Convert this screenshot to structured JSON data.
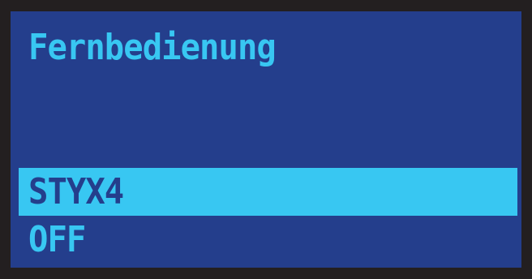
{
  "screen": {
    "title": "Fernbedienung",
    "menu": {
      "items": [
        {
          "label": "STYX4",
          "selected": true
        },
        {
          "label": "OFF",
          "selected": false
        }
      ]
    }
  },
  "colors": {
    "bezel": "#231f20",
    "background": "#243e8c",
    "text": "#38c7f2",
    "highlight": "#38c7f2",
    "highlight_text": "#243e8c"
  }
}
